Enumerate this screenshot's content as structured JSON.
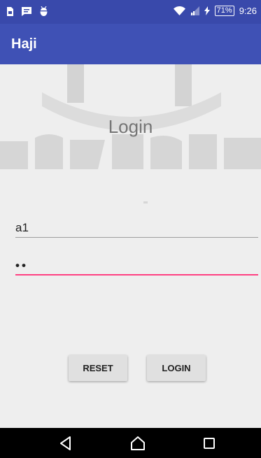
{
  "status_bar": {
    "time": "9:26",
    "battery": "71%",
    "icons": [
      "sim-card-icon",
      "message-icon",
      "android-debug-icon",
      "wifi-icon",
      "signal-icon",
      "charging-icon"
    ]
  },
  "app_bar": {
    "title": "Haji"
  },
  "login": {
    "title": "Login",
    "username_value": "a1",
    "password_value": "••",
    "reset_label": "RESET",
    "login_label": "LOGIN"
  },
  "nav_bar": {
    "icons": [
      "back-icon",
      "home-icon",
      "recents-icon"
    ]
  },
  "colors": {
    "status_bar": "#3949ab",
    "app_bar": "#3f51b5",
    "accent": "#ff4081",
    "background": "#eeeeee"
  }
}
